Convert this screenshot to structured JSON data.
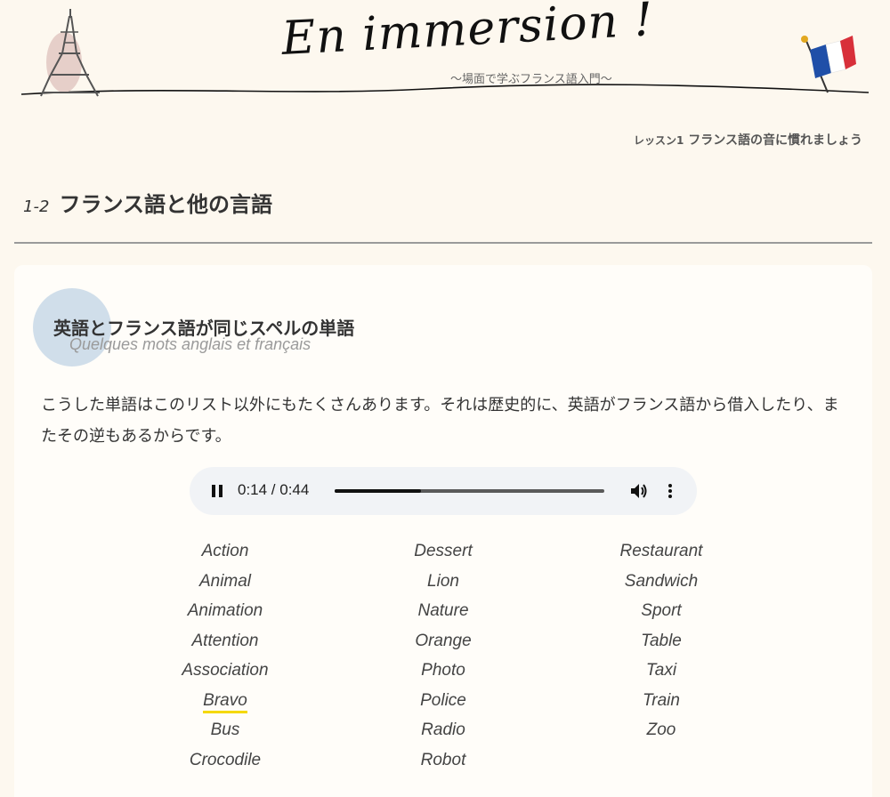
{
  "header": {
    "title": "En immersion !",
    "subtitle": "〜場面で学ぶフランス語入門〜",
    "left_illustration": "eiffel-tower-icon",
    "right_illustration": "french-flag-icon"
  },
  "lesson": {
    "prefix": "レッスン",
    "number": "1",
    "title": "フランス語の音に慣れましょう"
  },
  "section": {
    "number": "1-2",
    "title": "フランス語と他の言語"
  },
  "card": {
    "heading": "英語とフランス語が同じスペルの単語",
    "subheading": "Quelques mots anglais et français",
    "paragraph": "こうした単語はこのリスト以外にもたくさんあります。それは歴史的に、英語がフランス語から借入したり、またその逆もあるからです。"
  },
  "audio": {
    "current_time": "0:14",
    "duration": "0:44",
    "time_display": "0:14 / 0:44",
    "progress": 0.32,
    "state": "playing",
    "icons": [
      "pause-icon",
      "volume-icon",
      "more-options-icon"
    ]
  },
  "words": {
    "columns": [
      [
        "Action",
        "Animal",
        "Animation",
        "Attention",
        "Association",
        "Bravo",
        "Bus",
        "Crocodile"
      ],
      [
        "Dessert",
        "Lion",
        "Nature",
        "Orange",
        "Photo",
        "Police",
        "Radio",
        "Robot"
      ],
      [
        "Restaurant",
        "Sandwich",
        "Sport",
        "Table",
        "Taxi",
        "Train",
        "Zoo"
      ]
    ],
    "highlighted": "Bravo",
    "highlight_color": "#f5d800"
  },
  "colors": {
    "background": "#fdf8ef",
    "card": "#fffdf9",
    "accent_circle": "#c8d8e8",
    "flag_blue": "#1f4fa8",
    "flag_red": "#d8303a"
  }
}
